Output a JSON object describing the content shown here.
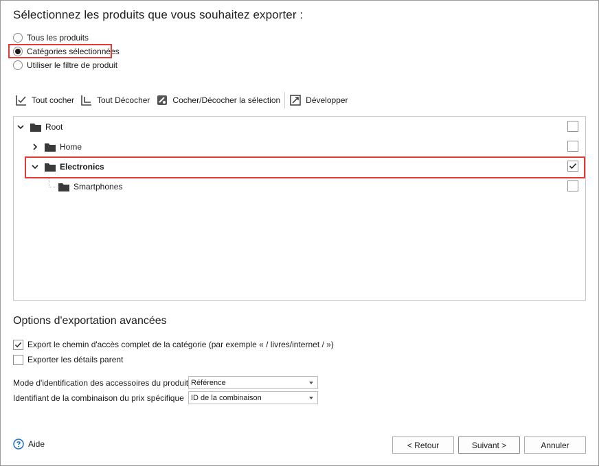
{
  "heading": "Sélectionnez les produits que vous souhaitez exporter :",
  "radio_options": [
    {
      "label": "Tous les produits",
      "selected": false
    },
    {
      "label": "Catégories sélectionnées",
      "selected": true
    },
    {
      "label": "Utiliser le filtre de produit",
      "selected": false
    }
  ],
  "toolbar": {
    "check_all": "Tout cocher",
    "uncheck_all": "Tout Décocher",
    "toggle_selection": "Cocher/Décocher la sélection",
    "expand": "Développer"
  },
  "tree": {
    "root": {
      "label": "Root",
      "expanded": true,
      "checked": false
    },
    "home": {
      "label": "Home",
      "expanded": false,
      "checked": false
    },
    "electronics": {
      "label": "Electronics",
      "expanded": true,
      "checked": true
    },
    "smartphones": {
      "label": "Smartphones",
      "checked": false
    }
  },
  "advanced": {
    "title": "Options d'exportation avancées",
    "export_path": {
      "label": "Export le chemin d'accès complet de la catégorie (par exemple « / livres/internet / »)",
      "checked": true
    },
    "export_parent": {
      "label": "Exporter les détails parent",
      "checked": false
    },
    "accessory_mode": {
      "label": "Mode d'identification des accessoires du produit",
      "value": "Référence"
    },
    "combination_id": {
      "label": "Identifiant de la combinaison du prix spécifique",
      "value": "ID de la combinaison"
    }
  },
  "footer": {
    "help": "Aide",
    "back": "< Retour",
    "next": "Suivant >",
    "cancel": "Annuler"
  },
  "colors": {
    "highlight": "#e53935",
    "folder": "#3a3a3a"
  }
}
